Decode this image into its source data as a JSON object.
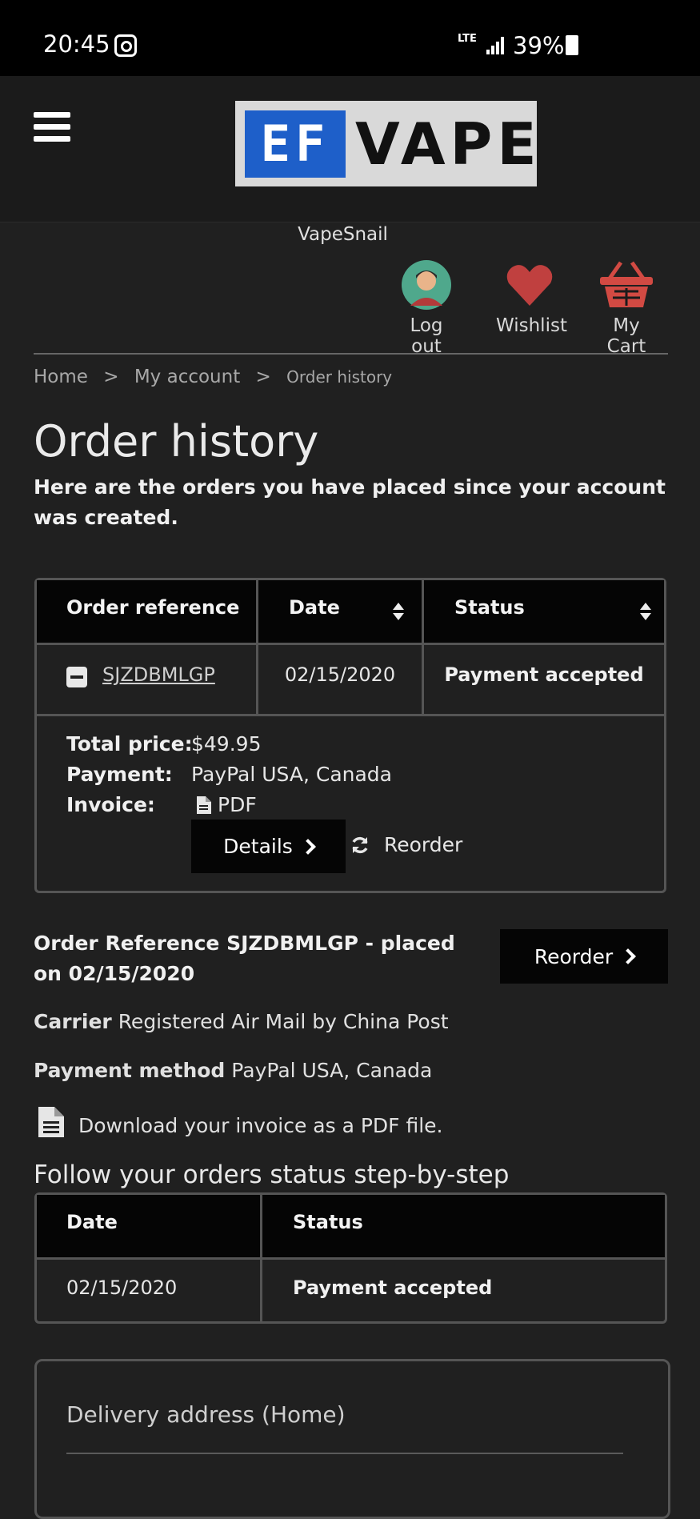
{
  "status_bar": {
    "time": "20:45",
    "network": "LTE",
    "battery": "39%",
    "icons": [
      "instagram-icon",
      "signal-icon",
      "battery-icon"
    ]
  },
  "header": {
    "menu_icon": "hamburger-icon",
    "logo_mark": "EF",
    "logo_text": "VAPE",
    "username": "VapeSnail",
    "nav": {
      "logout": "Log out",
      "wishlist": "Wishlist",
      "cart": "My Cart"
    }
  },
  "breadcrumb": {
    "home": "Home",
    "sep": ">",
    "account": "My account",
    "current": "Order history"
  },
  "page": {
    "title": "Order history",
    "intro": "Here are the orders you have placed since your account was created."
  },
  "orders_table": {
    "headers": {
      "reference": "Order reference",
      "date": "Date",
      "status": "Status"
    },
    "row": {
      "reference": "SJZDBMLGP",
      "date": "02/15/2020",
      "status": "Payment accepted"
    },
    "expanded": {
      "total_label": "Total price:",
      "total_value": "$49.95",
      "payment_label": "Payment:",
      "payment_value": "PayPal USA, Canada",
      "invoice_label": "Invoice:",
      "invoice_value": "PDF",
      "details_button": "Details",
      "reorder_link": "Reorder"
    }
  },
  "order_detail": {
    "reference_line": "Order Reference SJZDBMLGP - placed on 02/15/2020",
    "reorder_button": "Reorder",
    "carrier_label": "Carrier",
    "carrier_value": "Registered Air Mail by China Post",
    "payment_label": "Payment method",
    "payment_value": "PayPal USA, Canada",
    "invoice_download": "Download your invoice as a PDF file.",
    "follow_title": "Follow your orders status step-by-step"
  },
  "history_table": {
    "headers": {
      "date": "Date",
      "status": "Status"
    },
    "row": {
      "date": "02/15/2020",
      "status": "Payment accepted"
    }
  },
  "delivery": {
    "title": "Delivery address (Home)"
  },
  "colors": {
    "background": "#202020",
    "header_bg": "#1b1b1b",
    "table_header": "#050505",
    "heart": "#c0403f",
    "cart": "#d24a43"
  }
}
